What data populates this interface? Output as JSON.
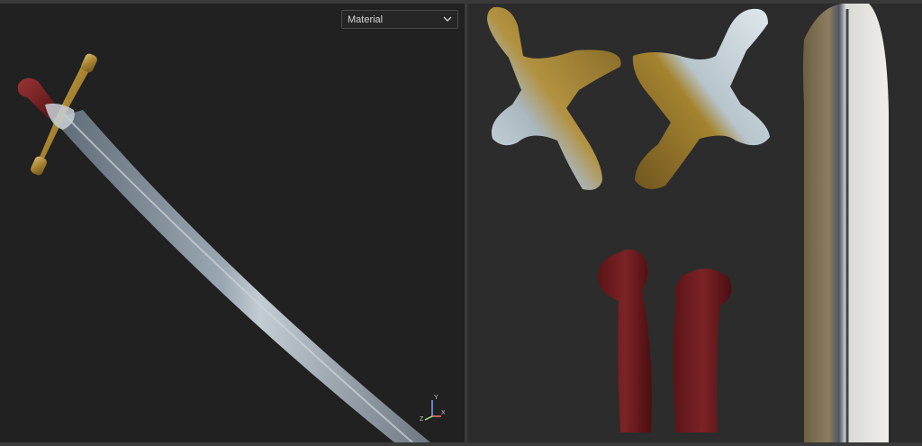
{
  "viewport3d": {
    "mode_select": {
      "value": "Material",
      "icon": "chevron-down-icon"
    },
    "axis_gizmo": {
      "y_label": "Y",
      "x_label": "X",
      "z_label": "Z",
      "icon": "axis-gizmo-icon"
    }
  },
  "viewport2d": {
    "uv_islands": [
      "guard-island-left",
      "guard-island-right",
      "grip-island-left",
      "grip-island-right",
      "blade-island"
    ]
  },
  "colors": {
    "viewport3d_bg": "#212121",
    "viewport2d_bg": "#2c2c2c",
    "brass": "#b08f3e",
    "grip_red": "#6e1c1e",
    "steel": "#9aa4ad"
  }
}
